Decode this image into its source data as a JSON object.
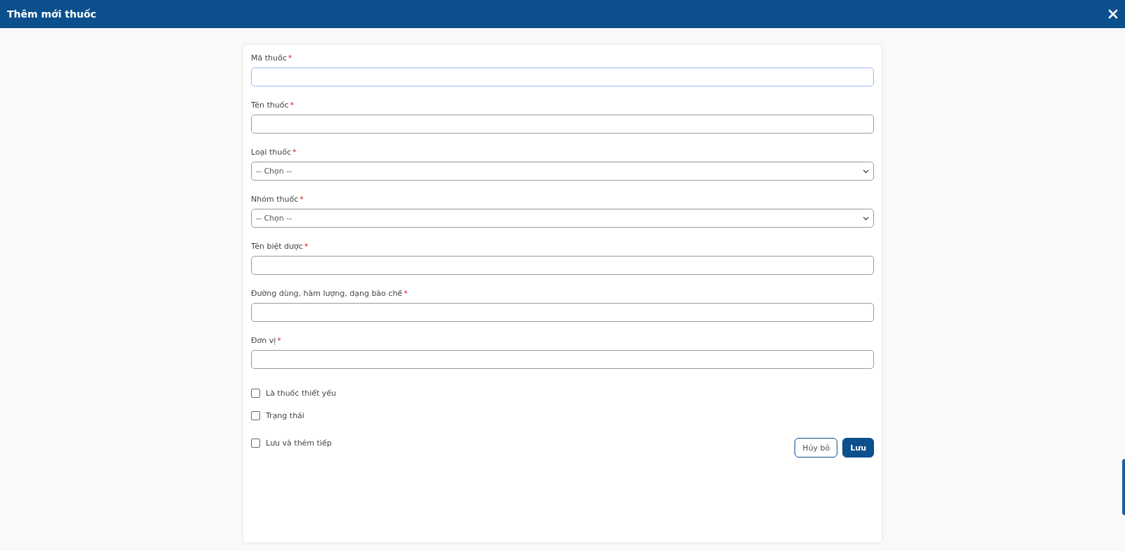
{
  "window": {
    "title": "Thêm mới thuốc"
  },
  "fields": [
    {
      "kind": "input",
      "label": "Mã thuốc",
      "required_mark": "*",
      "focused": true
    },
    {
      "kind": "input",
      "label": "Tên thuốc",
      "required_mark": "*",
      "focused": false
    },
    {
      "kind": "select",
      "label": "Loại thuốc",
      "required_mark": "*",
      "focused": false,
      "value": "-- Chọn --"
    },
    {
      "kind": "select",
      "label": "Nhóm thuốc",
      "required_mark": "*",
      "focused": false,
      "value": "-- Chọn --"
    },
    {
      "kind": "input",
      "label": "Tên biệt dược",
      "required_mark": "*",
      "focused": false
    },
    {
      "kind": "input",
      "label": "Đường dùng, hàm lượng, dạng bào chế",
      "required_mark": "*",
      "focused": false
    },
    {
      "kind": "input",
      "label": "Đơn vị",
      "required_mark": "*",
      "focused": false
    }
  ],
  "checkboxes": [
    {
      "label": "Là thuốc thiết yếu",
      "checked": false
    },
    {
      "label": "Trạng thái",
      "checked": false
    }
  ],
  "footer": {
    "checkbox": {
      "label": "Lưu và thêm tiếp",
      "checked": false
    },
    "buttons": [
      {
        "label": "Hủy bỏ",
        "kind": "secondary"
      },
      {
        "label": "Lưu",
        "kind": "primary"
      }
    ]
  }
}
